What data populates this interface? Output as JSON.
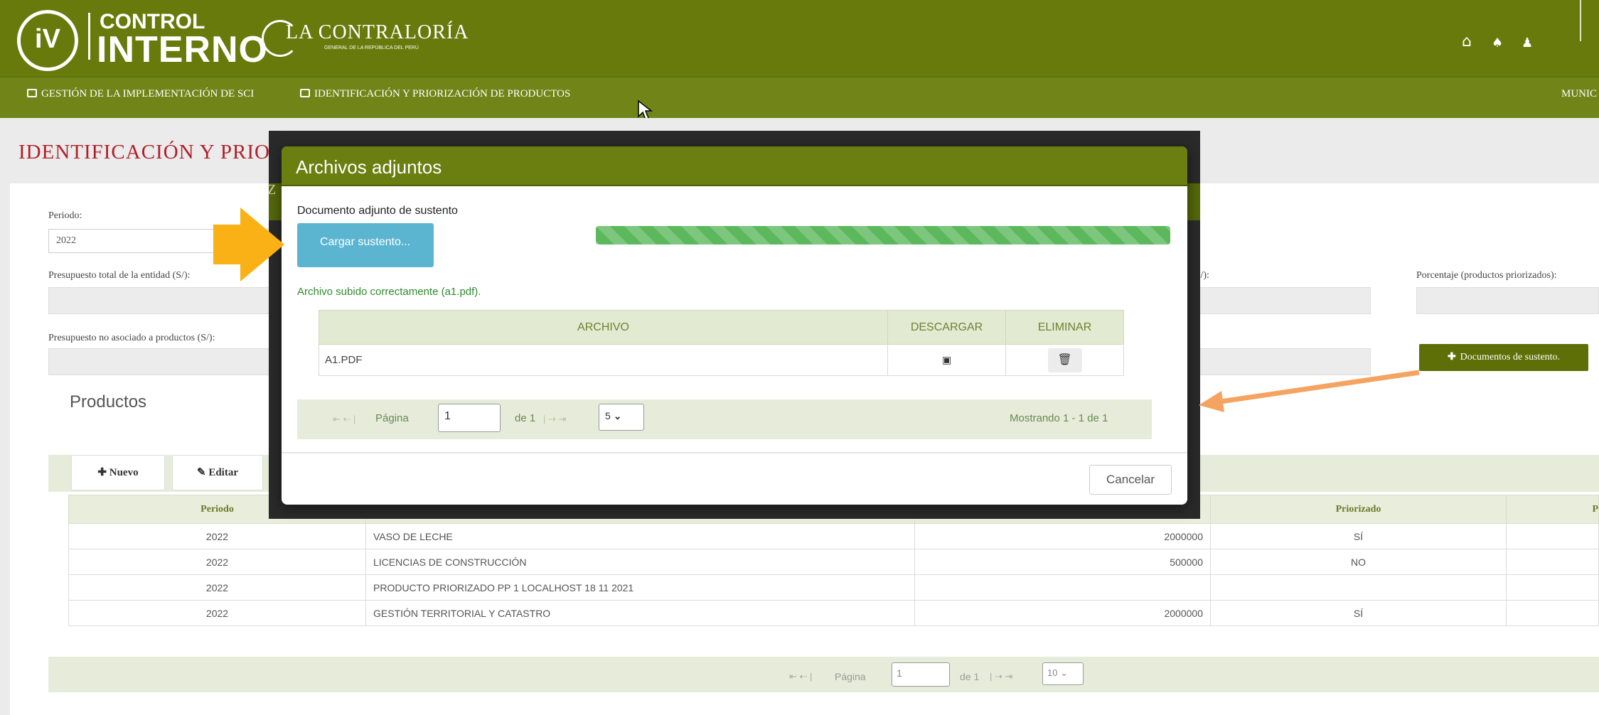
{
  "header": {
    "logo_iv": "iV",
    "logo_control": "CONTROL",
    "logo_interno": "INTERNO",
    "contraloria_title": "LA CONTRALORÍA",
    "contraloria_sub": "GENERAL DE LA REPÚBLICA DEL PERÚ",
    "icons": [
      "home-icon",
      "bell-icon",
      "user-icon"
    ]
  },
  "menu": {
    "items": [
      "GESTIÓN DE LA IMPLEMENTACIÓN DE SCI",
      "IDENTIFICACIÓN Y PRIORIZACIÓN DE PRODUCTOS"
    ],
    "right_text": "MUNIC"
  },
  "page": {
    "title": "IDENTIFICACIÓN Y PRIOR",
    "hidden_fragment": "Z"
  },
  "form": {
    "periodo_label": "Periodo:",
    "periodo_value": "2022",
    "presupuesto_total_label": "Presupuesto total de la entidad (S/):",
    "presupuesto_right_label": "(S/):",
    "porcentaje_label": "Porcentaje (productos priorizados):",
    "presupuesto_no_asociado_label": "Presupuesto no asociado a productos (S/):",
    "documentos_button": "Documentos de sustento."
  },
  "productos": {
    "title": "Productos",
    "nuevo_button": "Nuevo",
    "editar_button": "Editar",
    "columns": [
      "Periodo",
      "",
      "",
      "Priorizado",
      "P"
    ],
    "rows": [
      [
        "2022",
        "VASO DE LECHE",
        "2000000",
        "SÍ"
      ],
      [
        "2022",
        "LICENCIAS DE CONSTRUCCIÓN",
        "500000",
        "NO"
      ],
      [
        "2022",
        "PRODUCTO PRIORIZADO PP 1 LOCALHOST 18 11 2021",
        "",
        ""
      ],
      [
        "2022",
        "GESTIÓN TERRITORIAL Y CATASTRO",
        "2000000",
        "SÍ"
      ]
    ],
    "pager": {
      "page_label": "Página",
      "page": "1",
      "of": "de 1",
      "per_page": "10"
    }
  },
  "modal": {
    "title": "Archivos adjuntos",
    "doc_label": "Documento adjunto de sustento",
    "upload_button": "Cargar sustento...",
    "progress": 1.0,
    "success_message": "Archivo subido correctamente (a1.pdf).",
    "columns": [
      "ARCHIVO",
      "DESCARGAR",
      "ELIMINAR"
    ],
    "files": [
      {
        "name": "A1.PDF"
      }
    ],
    "pager": {
      "page_label": "Página",
      "page": "1",
      "of": "de 1",
      "per_page": "5",
      "showing": "Mostrando 1 - 1 de 1"
    },
    "cancel_button": "Cancelar"
  },
  "colors": {
    "header": "#677a0b",
    "title_red": "#b0202a",
    "upload_blue": "#5bb5d1",
    "progress_green": "#5cb85c",
    "arrow_yellow": "#f9b115",
    "arrow_orange": "#f4a460"
  }
}
